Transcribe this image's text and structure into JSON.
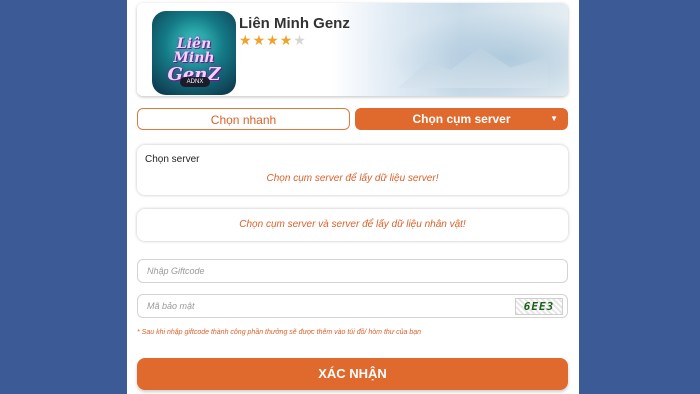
{
  "header": {
    "game_title": "Liên Minh Genz",
    "rating": 4,
    "rating_max": 5,
    "logo_text_line1": "Liên Minh",
    "logo_text_line2": "GenZ",
    "logo_badge": "ADNX"
  },
  "tabs": {
    "quick_label": "Chọn nhanh",
    "cluster_label": "Chọn cụm server"
  },
  "server_card": {
    "label": "Chọn server",
    "message": "Chọn cụm server để lấy dữ liệu server!"
  },
  "character_card": {
    "message": "Chọn cụm server và server để lấy dữ liệu nhân vật!"
  },
  "giftcode": {
    "placeholder": "Nhập Giftcode"
  },
  "captcha": {
    "placeholder": "Mã bảo mật",
    "code": "6EE3"
  },
  "note": "* Sau khi nhập giftcode thành công phần thưởng sẽ được thêm vào túi đồ/ hòm thư của bạn",
  "submit_label": "XÁC NHẬN",
  "colors": {
    "accent": "#e0692d",
    "background": "#3c5b96"
  }
}
